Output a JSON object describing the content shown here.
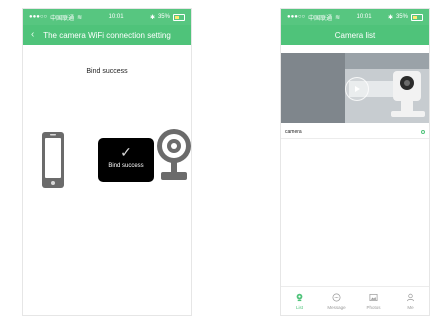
{
  "colors": {
    "accent_green": "#4fc37a",
    "toast_black": "#000000",
    "text_dark": "#222222",
    "gray": "#6b6b6b"
  },
  "left_screen": {
    "status_bar": {
      "carrier": "中国联通",
      "time": "10:01",
      "battery": "35%",
      "icons": [
        "signal-icon",
        "wifi-icon",
        "bluetooth-icon",
        "battery-icon"
      ]
    },
    "navbar": {
      "back_icon": "chevron-left-icon",
      "title": "The camera WiFi connection setting"
    },
    "content": {
      "heading": "Bind success",
      "toast": {
        "icon": "check-icon",
        "label": "Bind success"
      },
      "illustration_icons": [
        "phone-icon",
        "check-icon",
        "camera-icon"
      ]
    }
  },
  "right_screen": {
    "status_bar": {
      "carrier": "中国联通",
      "time": "10:01",
      "battery": "35%",
      "icons": [
        "signal-icon",
        "wifi-icon",
        "bluetooth-icon",
        "battery-icon"
      ]
    },
    "navbar": {
      "title": "Camera list"
    },
    "camera_list": {
      "items": [
        {
          "name": "camera",
          "status_icon": "online-dot-icon",
          "thumbnail_icon": "play-icon"
        }
      ]
    },
    "tabbar": {
      "tabs": [
        {
          "label": "List",
          "icon": "camera-icon",
          "active": true
        },
        {
          "label": "Message",
          "icon": "chat-icon",
          "active": false
        },
        {
          "label": "Photos",
          "icon": "image-icon",
          "active": false
        },
        {
          "label": "Me",
          "icon": "person-icon",
          "active": false
        }
      ]
    }
  }
}
